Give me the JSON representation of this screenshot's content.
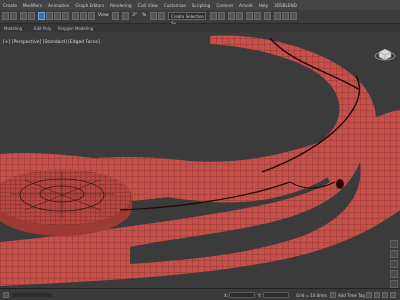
{
  "menu": {
    "items": [
      "Create",
      "Modifiers",
      "Animation",
      "Graph Editors",
      "Rendering",
      "Civil View",
      "Customize",
      "Scripting",
      "Content",
      "Arnold",
      "Help",
      "3DSBLEND"
    ]
  },
  "toolbar": {
    "view_label": "View",
    "angle_label": "3°",
    "percent_label": "%",
    "selection_set_placeholder": "Create Selection Se"
  },
  "ribbon": {
    "items": [
      "Modeling",
      "Edit Poly",
      "Polygon Modeling"
    ]
  },
  "viewport": {
    "label": "[+] [Perspective] [Standard] [Edged Faces]",
    "mesh_color": "#c8504a",
    "wire_color": "#3a1410",
    "background": "#3b3b3b"
  },
  "statusbar": {
    "grid_label": "Grid = 10.0mm",
    "add_time_tag": "Add Time Tag",
    "coord_x": "X:",
    "coord_y": "Y:"
  }
}
